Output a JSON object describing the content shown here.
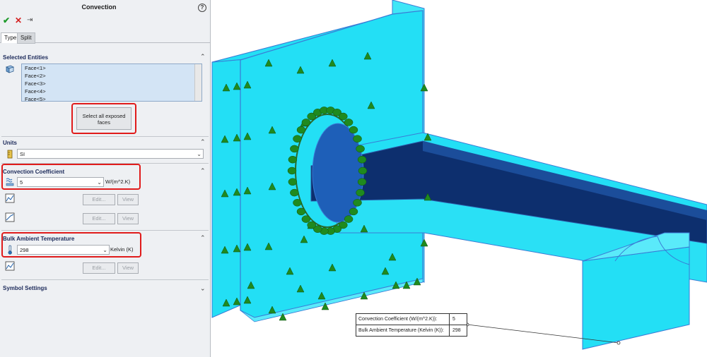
{
  "panel": {
    "title": "Convection",
    "help_glyph": "?",
    "ok_glyph": "✔",
    "cancel_glyph": "✕",
    "pin_glyph": "⇥",
    "tabs": [
      {
        "label": "Type"
      },
      {
        "label": "Split"
      }
    ],
    "selected_entities": {
      "header": "Selected Entities",
      "faces": [
        "Face<1>",
        "Face<2>",
        "Face<3>",
        "Face<4>",
        "Face<5>"
      ],
      "select_all_button": "Select all exposed faces"
    },
    "units": {
      "header": "Units",
      "value": "SI"
    },
    "convection_coefficient": {
      "header": "Convection Coefficient",
      "value": "5",
      "unit": "W/(m^2.K)",
      "edit_label": "Edit...",
      "view_label": "View"
    },
    "bulk_ambient_temperature": {
      "header": "Bulk Ambient Temperature",
      "value": "298",
      "unit": "Kelvin (K)",
      "edit_label": "Edit...",
      "view_label": "View"
    },
    "symbol_settings": {
      "header": "Symbol Settings"
    },
    "chevron_glyph": "⌃"
  },
  "callout": {
    "rows": [
      {
        "label": "Convection Coefficient (W/(m^2.K)):",
        "value": "5"
      },
      {
        "label": "Bulk Ambient Temperature (Kelvin (K)):",
        "value": "298"
      }
    ]
  },
  "colors": {
    "model_fill": "#23dff5",
    "model_edge": "#3a7bd5",
    "beam_dark": "#0d2f6e",
    "symbol_green": "#1f8a1f",
    "highlight_red": "#e01b1b",
    "accent_blue": "#1c2a5a"
  }
}
